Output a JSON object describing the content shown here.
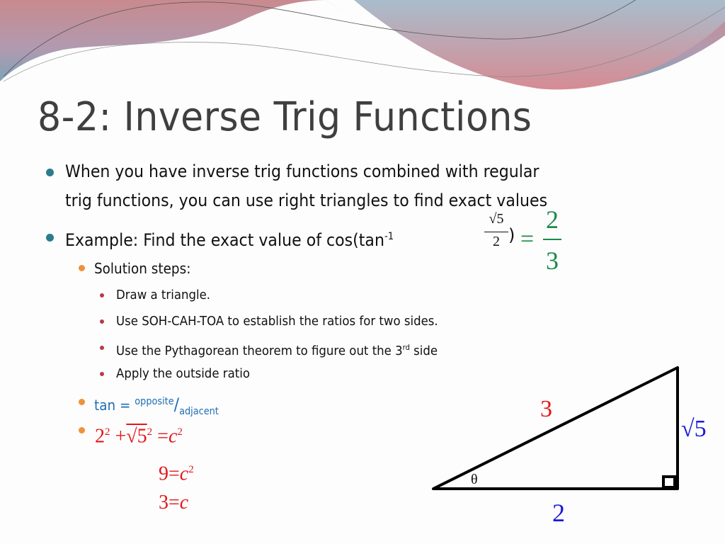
{
  "slide": {
    "title": "8-2: Inverse Trig Functions",
    "bullets": [
      {
        "line1": "When you have inverse trig functions combined with regular",
        "line2": "trig functions, you can use right triangles to find exact values"
      },
      {
        "prefix": "Example: Find the exact value of cos(tan",
        "sup": "-1",
        "frac_num": "√5",
        "frac_den": "2",
        "close": ")",
        "equals": "=",
        "answer_num": "2",
        "answer_den": "3"
      }
    ],
    "solution_label": "Solution steps:",
    "steps": [
      {
        "text": "Draw a triangle."
      },
      {
        "text": "Use SOH-CAH-TOA to establish the ratios for two sides."
      },
      {
        "text": "Use the Pythagorean theorem to figure out the 3",
        "sup": "rd",
        "suffix": " side"
      },
      {
        "text": "Apply the outside ratio"
      }
    ],
    "tan_ratio": {
      "lhs": "tan = ",
      "numerator": "opposite",
      "slash": "/",
      "denominator": "adjacent"
    },
    "pythagoras": {
      "line1": {
        "a": "2",
        "a_exp": "2",
        "plus": "+",
        "b": "√5",
        "b_exp": "2",
        "eq": "=",
        "c": "c",
        "c_exp": "2"
      },
      "line2": {
        "lhs": "9",
        "eq": "=",
        "c": "c",
        "c_exp": "2"
      },
      "line3": {
        "lhs": "3",
        "eq": "=",
        "c": "c"
      }
    },
    "triangle": {
      "hypotenuse_label": "3",
      "opposite_label": "√5",
      "adjacent_label": "2",
      "angle_label": "θ"
    },
    "colors": {
      "title": "#3f3f3f",
      "accent_teal": "#2e7a8e",
      "accent_orange": "#f0913a",
      "accent_red": "#b83a4b",
      "math_red": "#e3161b",
      "math_green": "#1a8a4a",
      "math_blue": "#1a1ad8",
      "link_blue": "#1f6fb5"
    }
  }
}
